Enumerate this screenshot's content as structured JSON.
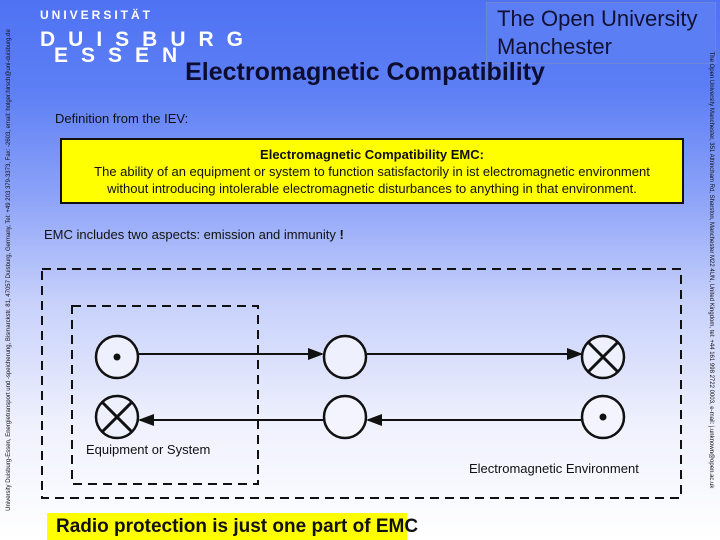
{
  "logo": {
    "line1": "UNIVERSITÄT",
    "line2": "DUISBURG",
    "line3": "ESSEN"
  },
  "partner": {
    "line1": "The Open University",
    "line2": "Manchester"
  },
  "title": "Electromagnetic Compatibility",
  "side_left_text": "University Duisburg-Essen, Energietransport und -speicherung, Bismarckstr. 81, 47057 Duisburg, Germany, Tel: +49 203 379-3373, Fax: -2603, email: holger.hirsch@uni-duisburg.de",
  "side_right_text": "The Open University Manchester, 351 Altrincham Rd, Sharston, Manchester M22 4UN, United Kingdom, tel: +44 161 998 2722 0003, e-mail: j.unknown@open.ac.uk",
  "definition": {
    "label": "Definition from the IEV:",
    "heading": "Electromagnetic Compatibility EMC:",
    "line1": "The ability of an equipment or system to function satisfactorily in ist electromagnetic environment",
    "line2": "without introducing intolerable electromagnetic disturbances to anything in that environment."
  },
  "aspects": {
    "text": "EMC includes two aspects: emission and immunity",
    "bang": "!"
  },
  "diagram": {
    "equipment_label": "Equipment or System",
    "environment_label": "Electromagnetic Environment",
    "rows": [
      {
        "name": "emission",
        "direction": "right",
        "nodes": [
          "dot",
          "empty",
          "cross"
        ]
      },
      {
        "name": "immunity",
        "direction": "left",
        "nodes": [
          "cross",
          "empty",
          "dot"
        ]
      }
    ]
  },
  "conclusion": "Radio protection is just one part of EMC",
  "colors": {
    "highlight": "#ffff00",
    "background_top": "#4f72f3",
    "text": "#111111"
  }
}
